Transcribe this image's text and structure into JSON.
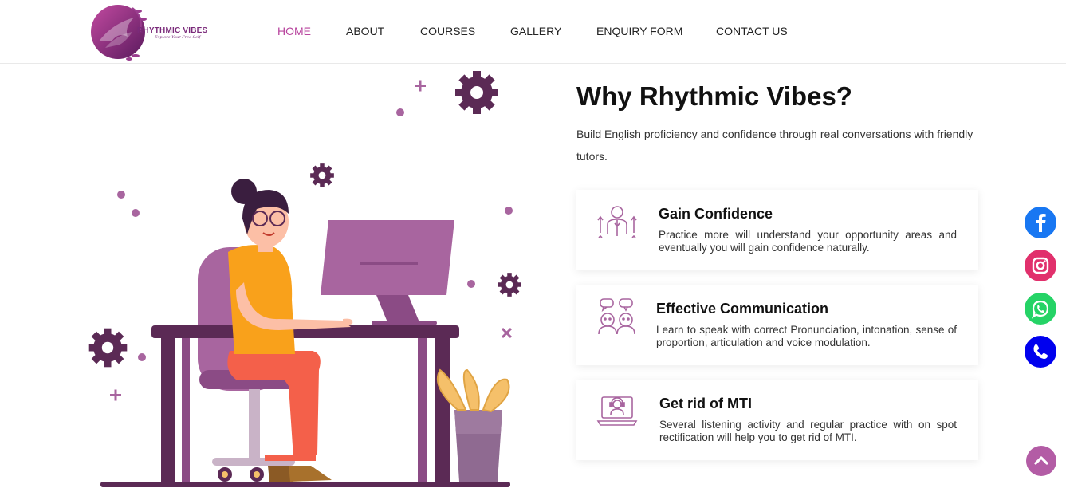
{
  "brand": {
    "name": "RHYTHMIC VIBES",
    "tagline": "Explore Your Free Self",
    "color": "#7a2a7a"
  },
  "nav": {
    "items": [
      {
        "label": "HOME",
        "active": true
      },
      {
        "label": "ABOUT",
        "active": false
      },
      {
        "label": "COURSES",
        "active": false
      },
      {
        "label": "GALLERY",
        "active": false
      },
      {
        "label": "ENQUIRY FORM",
        "active": false
      },
      {
        "label": "CONTACT US",
        "active": false
      }
    ],
    "active_color": "#b8459e"
  },
  "main": {
    "title": "Why Rhythmic Vibes?",
    "subtitle": "Build English proficiency and confidence through real conversations with friendly tutors."
  },
  "features": [
    {
      "icon": "confidence-person-icon",
      "title": "Gain Confidence",
      "description": "Practice more will understand your opportunity areas and eventually you will gain confidence naturally."
    },
    {
      "icon": "communication-chat-icon",
      "title": "Effective Communication",
      "description": "Learn to speak with correct Pronunciation, intonation, sense of proportion, articulation and voice modulation."
    },
    {
      "icon": "laptop-headset-icon",
      "title": "Get rid of MTI",
      "description": "Several listening activity and regular practice with on spot rectification will help you to get rid of MTI."
    }
  ],
  "social": {
    "facebook_color": "#1877f2",
    "instagram_color": "#e1306c",
    "whatsapp_color": "#25d366",
    "phone_color": "#0000ee"
  },
  "accent_color": "#a8659f"
}
